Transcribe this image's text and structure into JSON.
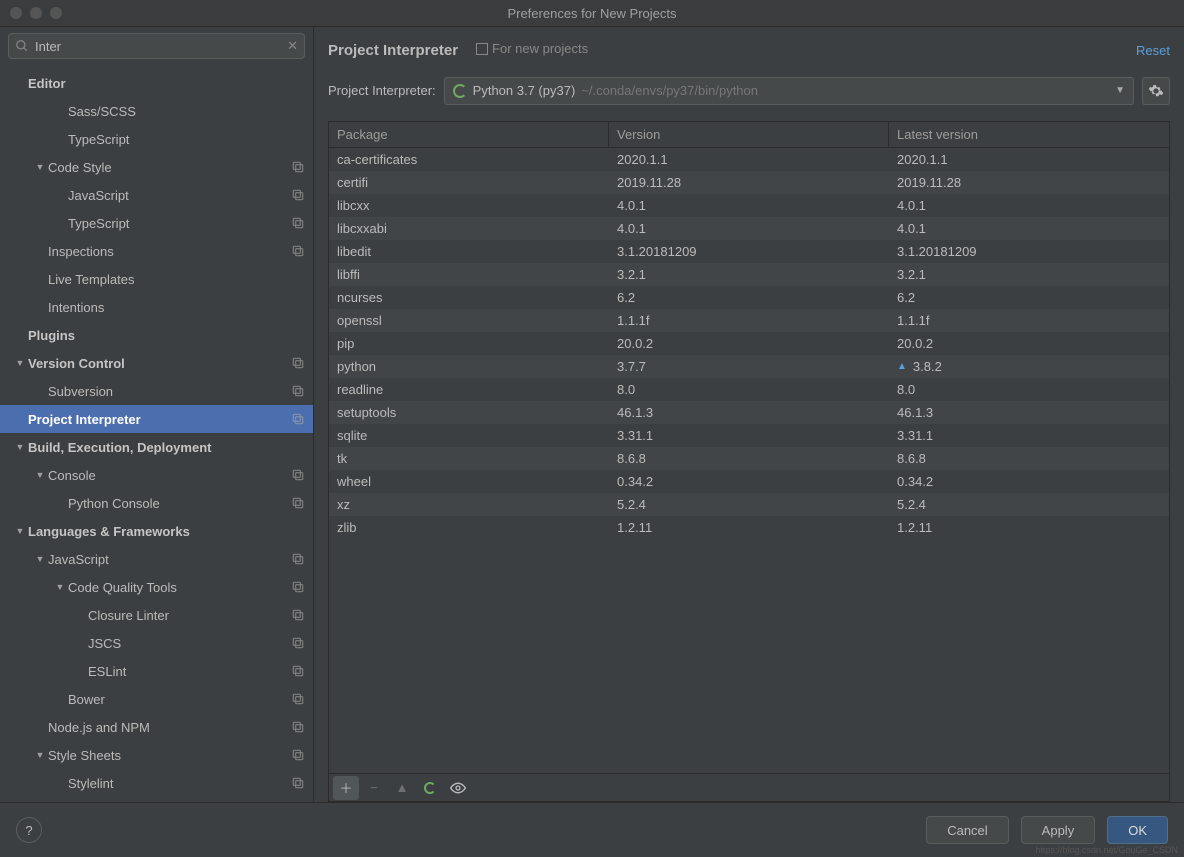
{
  "window": {
    "title": "Preferences for New Projects"
  },
  "search": {
    "value": "Inter"
  },
  "sidebar": [
    {
      "label": "Editor",
      "indent": 0,
      "bold": true,
      "tri": ""
    },
    {
      "label": "Sass/SCSS",
      "indent": 2,
      "tri": ""
    },
    {
      "label": "TypeScript",
      "indent": 2,
      "tri": ""
    },
    {
      "label": "Code Style",
      "indent": 1,
      "tri": "▼",
      "copy": true
    },
    {
      "label": "JavaScript",
      "indent": 2,
      "copy": true
    },
    {
      "label": "TypeScript",
      "indent": 2,
      "copy": true
    },
    {
      "label": "Inspections",
      "indent": 1,
      "copy": true
    },
    {
      "label": "Live Templates",
      "indent": 1
    },
    {
      "label": "Intentions",
      "indent": 1
    },
    {
      "label": "Plugins",
      "indent": 0,
      "bold": true
    },
    {
      "label": "Version Control",
      "indent": 0,
      "bold": true,
      "tri": "▼",
      "copy": true
    },
    {
      "label": "Subversion",
      "indent": 1,
      "copy": true
    },
    {
      "label": "Project Interpreter",
      "indent": 0,
      "bold": true,
      "selected": true,
      "copy": true
    },
    {
      "label": "Build, Execution, Deployment",
      "indent": 0,
      "bold": true,
      "tri": "▼"
    },
    {
      "label": "Console",
      "indent": 1,
      "tri": "▼",
      "copy": true
    },
    {
      "label": "Python Console",
      "indent": 2,
      "copy": true
    },
    {
      "label": "Languages & Frameworks",
      "indent": 0,
      "bold": true,
      "tri": "▼"
    },
    {
      "label": "JavaScript",
      "indent": 1,
      "tri": "▼",
      "copy": true
    },
    {
      "label": "Code Quality Tools",
      "indent": 2,
      "tri": "▼",
      "copy": true
    },
    {
      "label": "Closure Linter",
      "indent": 3,
      "copy": true
    },
    {
      "label": "JSCS",
      "indent": 3,
      "copy": true
    },
    {
      "label": "ESLint",
      "indent": 3,
      "copy": true
    },
    {
      "label": "Bower",
      "indent": 2,
      "copy": true
    },
    {
      "label": "Node.js and NPM",
      "indent": 1,
      "copy": true
    },
    {
      "label": "Style Sheets",
      "indent": 1,
      "tri": "▼",
      "copy": true
    },
    {
      "label": "Stylelint",
      "indent": 2,
      "copy": true
    }
  ],
  "header": {
    "title": "Project Interpreter",
    "sub": "For new projects",
    "reset": "Reset"
  },
  "interpreter": {
    "label": "Project Interpreter:",
    "name": "Python 3.7 (py37)",
    "path": "~/.conda/envs/py37/bin/python"
  },
  "table": {
    "cols": [
      "Package",
      "Version",
      "Latest version"
    ],
    "rows": [
      {
        "p": "ca-certificates",
        "v": "2020.1.1",
        "l": "2020.1.1"
      },
      {
        "p": "certifi",
        "v": "2019.11.28",
        "l": "2019.11.28"
      },
      {
        "p": "libcxx",
        "v": "4.0.1",
        "l": "4.0.1"
      },
      {
        "p": "libcxxabi",
        "v": "4.0.1",
        "l": "4.0.1"
      },
      {
        "p": "libedit",
        "v": "3.1.20181209",
        "l": "3.1.20181209"
      },
      {
        "p": "libffi",
        "v": "3.2.1",
        "l": "3.2.1"
      },
      {
        "p": "ncurses",
        "v": "6.2",
        "l": "6.2"
      },
      {
        "p": "openssl",
        "v": "1.1.1f",
        "l": "1.1.1f"
      },
      {
        "p": "pip",
        "v": "20.0.2",
        "l": "20.0.2"
      },
      {
        "p": "python",
        "v": "3.7.7",
        "l": "3.8.2",
        "up": true
      },
      {
        "p": "readline",
        "v": "8.0",
        "l": "8.0"
      },
      {
        "p": "setuptools",
        "v": "46.1.3",
        "l": "46.1.3"
      },
      {
        "p": "sqlite",
        "v": "3.31.1",
        "l": "3.31.1"
      },
      {
        "p": "tk",
        "v": "8.6.8",
        "l": "8.6.8"
      },
      {
        "p": "wheel",
        "v": "0.34.2",
        "l": "0.34.2"
      },
      {
        "p": "xz",
        "v": "5.2.4",
        "l": "5.2.4"
      },
      {
        "p": "zlib",
        "v": "1.2.11",
        "l": "1.2.11"
      }
    ]
  },
  "footer": {
    "cancel": "Cancel",
    "apply": "Apply",
    "ok": "OK"
  },
  "watermark": "https://blog.csdn.net/GouGe_CSDN"
}
